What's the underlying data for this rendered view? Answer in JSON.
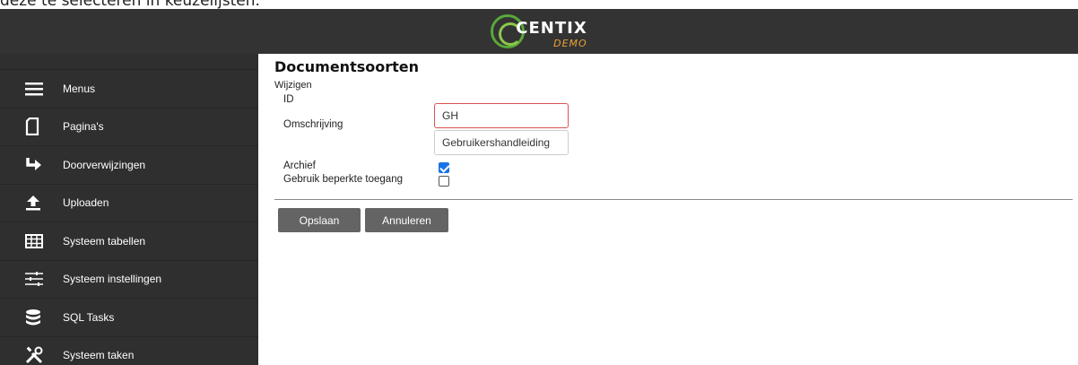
{
  "caption": "deze te selecteren in keuzelijsten.",
  "header": {
    "logo_text": "CENTIX",
    "logo_sub": "DEMO"
  },
  "sidebar": {
    "items": [
      {
        "label": "Menus",
        "icon": "menu-icon"
      },
      {
        "label": "Pagina's",
        "icon": "page-icon"
      },
      {
        "label": "Doorverwijzingen",
        "icon": "redirect-icon"
      },
      {
        "label": "Uploaden",
        "icon": "upload-icon"
      },
      {
        "label": "Systeem tabellen",
        "icon": "table-icon"
      },
      {
        "label": "Systeem instellingen",
        "icon": "sliders-icon"
      },
      {
        "label": "SQL Tasks",
        "icon": "database-icon"
      },
      {
        "label": "Systeem taken",
        "icon": "tools-icon"
      }
    ]
  },
  "main": {
    "title": "Documentsoorten",
    "section": "Wijzigen",
    "fields": {
      "id": {
        "label": "ID",
        "value": "GH"
      },
      "description": {
        "label": "Omschrijving",
        "value": "Gebruikershandleiding"
      },
      "archive": {
        "label": "Archief",
        "checked": true
      },
      "restricted": {
        "label": "Gebruik beperkte toegang",
        "checked": false
      }
    },
    "buttons": {
      "save": "Opslaan",
      "cancel": "Annuleren"
    }
  },
  "colors": {
    "topbar": "#333333",
    "sidebar": "#2f2f2f",
    "button": "#646464",
    "checkbox_on": "#1a73e8",
    "invalid_border": "#d9534f"
  }
}
